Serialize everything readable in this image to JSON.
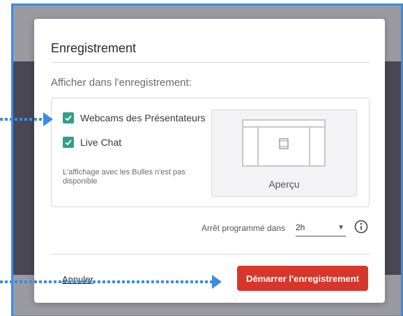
{
  "modal": {
    "title": "Enregistrement",
    "section_label": "Afficher dans l'enregistrement:",
    "options": [
      {
        "label": "Webcams des Présentateurs",
        "checked": true
      },
      {
        "label": "Live Chat",
        "checked": true
      }
    ],
    "note": "L'affichage avec les Bulles n'est pas disponible",
    "preview_label": "Aperçu",
    "scheduled_stop": {
      "label": "Arrêt programmé dans",
      "value": "2h"
    },
    "cancel_label": "Annuler",
    "start_label": "Démarrer l'enregistrement"
  },
  "colors": {
    "accent_checkbox": "#2ea08a",
    "primary_button": "#d6372a",
    "annotation_arrow": "#3a8be6",
    "backdrop": "#4a4754"
  }
}
